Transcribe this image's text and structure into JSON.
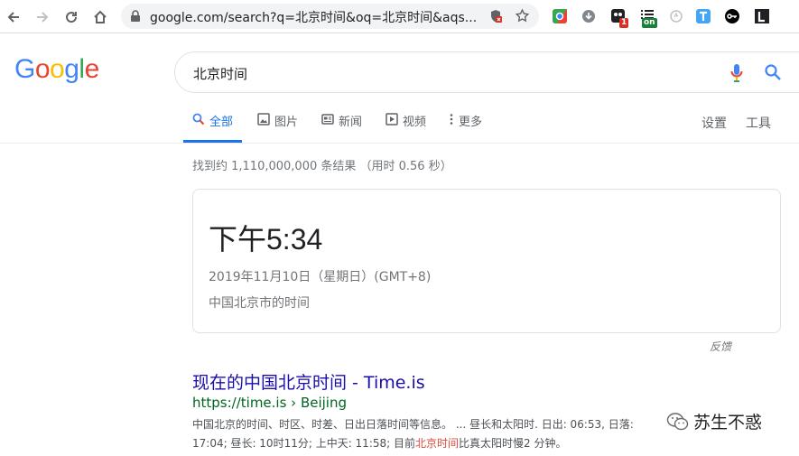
{
  "browser": {
    "url": "google.com/search?q=北京时间&oq=北京时间&aqs...",
    "extensions": [
      {
        "icon": "chrome-multicolor-icon"
      },
      {
        "icon": "download-circle-icon"
      },
      {
        "icon": "black-square-icon",
        "badge": "1",
        "badge_color": "#d93025"
      },
      {
        "icon": "list-lines-icon",
        "badge": "on",
        "badge_color": "#188038"
      },
      {
        "icon": "gray-circle-icon"
      },
      {
        "icon": "translate-t-icon"
      },
      {
        "icon": "key-icon"
      },
      {
        "icon": "black-l-icon"
      }
    ]
  },
  "google": {
    "logo": [
      "G",
      "o",
      "o",
      "g",
      "l",
      "e"
    ],
    "logo_colors": [
      "#4285F4",
      "#EA4335",
      "#FBBC05",
      "#4285F4",
      "#34A853",
      "#EA4335"
    ],
    "query": "北京时间"
  },
  "tabs": [
    {
      "label": "全部",
      "icon": "search-icon",
      "active": true
    },
    {
      "label": "图片",
      "icon": "image-icon"
    },
    {
      "label": "新闻",
      "icon": "news-icon"
    },
    {
      "label": "视频",
      "icon": "video-icon"
    },
    {
      "label": "更多",
      "icon": "more-dots-icon"
    }
  ],
  "tools": {
    "settings": "设置",
    "tools": "工具"
  },
  "stats": "找到约 1,110,000,000 条结果 （用时 0.56 秒）",
  "time_card": {
    "time": "下午5:34",
    "date": "2019年11月10日（星期日）(GMT+8)",
    "location": "中国北京市的时间"
  },
  "feedback": "反馈",
  "result": {
    "title": "现在的中国北京时间 - Time.is",
    "url": "https://time.is › Beijing",
    "snippet_line1": "中国北京的时间、时区、时差、日出日落时间等信息。 ... 昼长和太阳时. 日出: 06:53, 日落:",
    "snippet_line2_pre": "17:04; 昼长: 10时11分; 上中天: 11:58; 目前",
    "snippet_line2_em": "北京时间",
    "snippet_line2_post": "比真太阳时慢2 分钟。"
  },
  "watermark": {
    "text": "苏生不惑",
    "icon": "wechat-icon"
  },
  "colors": {
    "accent": "#1a73e8",
    "link": "#1a0dab",
    "url": "#006621"
  }
}
